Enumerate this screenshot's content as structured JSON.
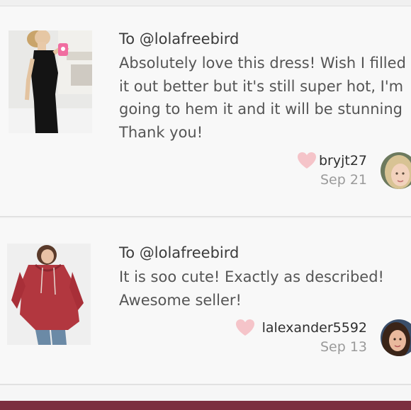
{
  "colors": {
    "background": "#f6f6f6",
    "heart": "#f5c4c9",
    "footer_bar": "#7b2f3f",
    "username": "#2f2f2f",
    "date": "#9a9a9a"
  },
  "reviews": [
    {
      "recipient": "To @lolafreebird",
      "comment": "Absolutely love this dress! Wish I filled\nit out better but it's still super hot, I'm\ngoing to hem it and it will be stunning\nThank you!",
      "username": "bryjt27",
      "date": "Sep 21",
      "photo_icon": "black-dress-photo",
      "avatar_icon": "user-avatar"
    },
    {
      "recipient": "To @lolafreebird",
      "comment": "It is soo cute! Exactly as described!\nAwesome seller!",
      "username": "lalexander5592",
      "date": "Sep 13",
      "photo_icon": "red-hoodie-photo",
      "avatar_icon": "user-avatar"
    }
  ]
}
